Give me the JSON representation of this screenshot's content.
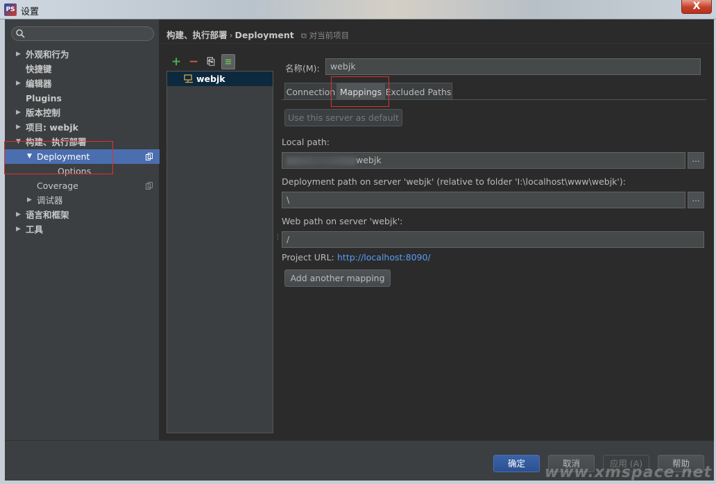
{
  "window": {
    "title": "设置",
    "close_label": "X",
    "app_icon_label": "PS"
  },
  "search": {
    "placeholder": ""
  },
  "tree": [
    {
      "label": "外观和行为",
      "arrow": "▶",
      "indent": 0,
      "bold": true
    },
    {
      "label": "快捷键",
      "arrow": "",
      "indent": 0,
      "bold": true
    },
    {
      "label": "编辑器",
      "arrow": "▶",
      "indent": 0,
      "bold": true
    },
    {
      "label": "Plugins",
      "arrow": "",
      "indent": 0,
      "bold": true
    },
    {
      "label": "版本控制",
      "arrow": "▶",
      "indent": 0,
      "bold": true
    },
    {
      "label": "项目: webjk",
      "arrow": "▶",
      "indent": 0,
      "bold": true
    },
    {
      "label": "构建、执行部署",
      "arrow": "▼",
      "indent": 0,
      "bold": true
    },
    {
      "label": "Deployment",
      "arrow": "▼",
      "indent": 1,
      "selected": true,
      "copy": true
    },
    {
      "label": "Options",
      "arrow": "",
      "indent": 2
    },
    {
      "label": "Coverage",
      "arrow": "",
      "indent": 1,
      "copy": true
    },
    {
      "label": "调试器",
      "arrow": "▶",
      "indent": 1
    },
    {
      "label": "语言和框架",
      "arrow": "▶",
      "indent": 0,
      "bold": true
    },
    {
      "label": "工具",
      "arrow": "▶",
      "indent": 0,
      "bold": true
    }
  ],
  "breadcrumb": {
    "parent": "构建、执行部署",
    "separator": "›",
    "current": "Deployment",
    "scope": "对当前项目"
  },
  "toolbar": {
    "add": "+",
    "remove": "−",
    "copy": "⎘",
    "default": "≡"
  },
  "servers": [
    {
      "name": "webjk"
    }
  ],
  "name_field": {
    "label": "名称(M):",
    "value": "webjk"
  },
  "tabs": [
    {
      "label": "Connection",
      "active": false
    },
    {
      "label": "Mappings",
      "active": true
    },
    {
      "label": "Excluded Paths",
      "active": false
    }
  ],
  "use_default_button": "Use this server as default",
  "local_path": {
    "label": "Local path:",
    "value": "webjk"
  },
  "deployment_path": {
    "label": "Deployment path on server 'webjk' (relative to folder 'I:\\localhost\\www\\webjk'):",
    "value": "\\"
  },
  "web_path": {
    "label": "Web path on server 'webjk':",
    "value": "/"
  },
  "project_url": {
    "label": "Project URL:",
    "value": "http://localhost:8090/"
  },
  "add_mapping_button": "Add another mapping",
  "browse_label": "...",
  "footer": {
    "ok": "确定",
    "cancel": "取消",
    "apply": "应用 (A)",
    "help": "帮助"
  },
  "watermark": "www.xmspace.net",
  "colors": {
    "selection": "#4b6eaf",
    "link": "#589df6",
    "highlight": "#e03030",
    "server_selected": "#0d293e"
  }
}
